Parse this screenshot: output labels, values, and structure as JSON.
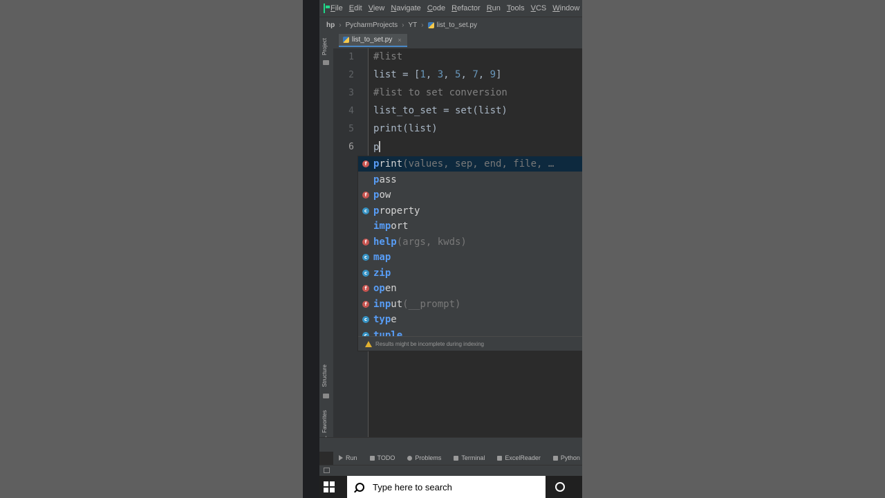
{
  "menubar": {
    "items": [
      "File",
      "Edit",
      "View",
      "Navigate",
      "Code",
      "Refactor",
      "Run",
      "Tools",
      "VCS",
      "Window"
    ]
  },
  "breadcrumbs": {
    "root": "hp",
    "project": "PycharmProjects",
    "folder": "YT",
    "file": "list_to_set.py"
  },
  "tool_window_tabs": {
    "project": "Project",
    "structure": "Structure",
    "favorites": "Favorites"
  },
  "editor": {
    "tab_label": "list_to_set.py",
    "tab_close": "×",
    "line_numbers": [
      "1",
      "2",
      "3",
      "4",
      "5",
      "6"
    ],
    "current_line": 6,
    "lines": {
      "l1": "#list",
      "l2_prefix": "list = [",
      "l2_n1": "1",
      "l2_n2": "3",
      "l2_n3": "5",
      "l2_n4": "7",
      "l2_n5": "9",
      "l2_sep": ", ",
      "l2_suffix": "]",
      "l3": "#list to set conversion",
      "l4": "list_to_set = set(list)",
      "l5": "print(list)",
      "l6": "p"
    }
  },
  "completion": {
    "items": [
      {
        "icon": "f",
        "match": "p",
        "rest": "rint",
        "params": "(values, sep, end, file, …"
      },
      {
        "icon": "none",
        "match": "p",
        "rest": "ass",
        "params": ""
      },
      {
        "icon": "f",
        "match": "p",
        "rest": "ow",
        "params": ""
      },
      {
        "icon": "c",
        "match": "p",
        "rest": "roperty",
        "params": ""
      },
      {
        "icon": "none",
        "match": "imp",
        "rest": "ort",
        "params": ""
      },
      {
        "icon": "f",
        "match": "help",
        "rest": "",
        "params": "(args, kwds)"
      },
      {
        "icon": "c",
        "match": "map",
        "rest": "",
        "params": ""
      },
      {
        "icon": "c",
        "match": "zip",
        "rest": "",
        "params": ""
      },
      {
        "icon": "f",
        "match": "op",
        "rest": "en",
        "params": ""
      },
      {
        "icon": "f",
        "match": "inp",
        "rest": "ut",
        "params": "(__prompt)"
      },
      {
        "icon": "c",
        "match": "typ",
        "rest": "e",
        "params": ""
      },
      {
        "icon": "c",
        "match": "tuple",
        "rest": "",
        "params": ""
      }
    ],
    "footer": "Results might be incomplete during indexing"
  },
  "bottom_tools": [
    "Run",
    "TODO",
    "Problems",
    "Terminal",
    "ExcelReader",
    "Python"
  ],
  "taskbar": {
    "search_placeholder": "Type here to search"
  },
  "colors": {
    "editor_bg": "#2b2b2b",
    "comment": "#808080",
    "number": "#6897bb",
    "match_highlight": "#589df6",
    "function_icon": "#c75450",
    "class_icon": "#3592c4"
  }
}
